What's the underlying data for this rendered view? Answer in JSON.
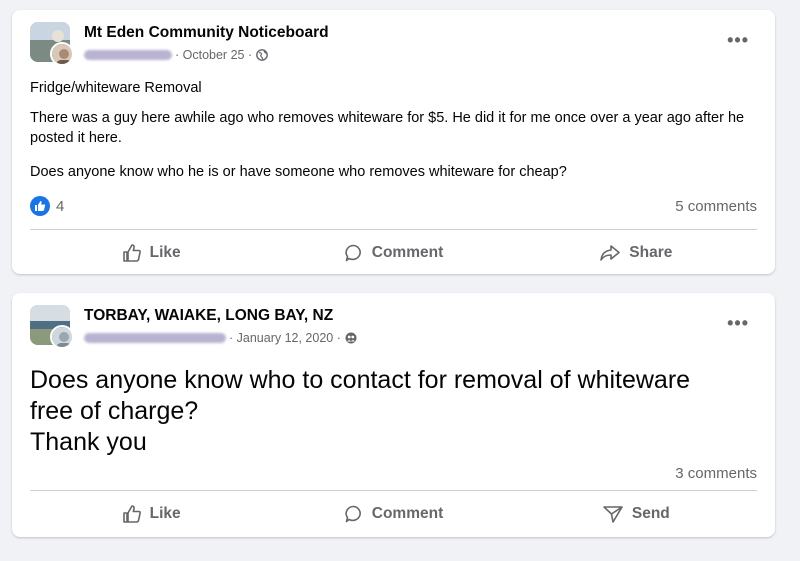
{
  "posts": [
    {
      "group_name": "Mt Eden Community Noticeboard",
      "date": "· October 25 ·",
      "privacy_icon": "globe-icon",
      "title": "Fridge/whiteware Removal",
      "paragraph1": "There was a guy here awhile ago who removes whiteware for $5. He did it for me once over a year ago after he posted it here.",
      "paragraph2": "Does anyone know who he is or have someone who removes whiteware for cheap?",
      "like_count": "4",
      "comments": "5 comments",
      "actions": {
        "like": "Like",
        "comment": "Comment",
        "share": "Share"
      }
    },
    {
      "group_name": "TORBAY, WAIAKE, LONG BAY, NZ",
      "date": "· January 12, 2020 ·",
      "privacy_icon": "group-members-icon",
      "text_line1": "Does anyone know who to contact for removal of whiteware",
      "text_line2": "free of charge?",
      "text_line3": "Thank you",
      "comments": "3 comments",
      "actions": {
        "like": "Like",
        "comment": "Comment",
        "send": "Send"
      }
    }
  ],
  "colors": {
    "background": "#f0f2f5",
    "card": "#ffffff",
    "secondary_text": "#65676b",
    "like_blue": "#1b74e4"
  }
}
